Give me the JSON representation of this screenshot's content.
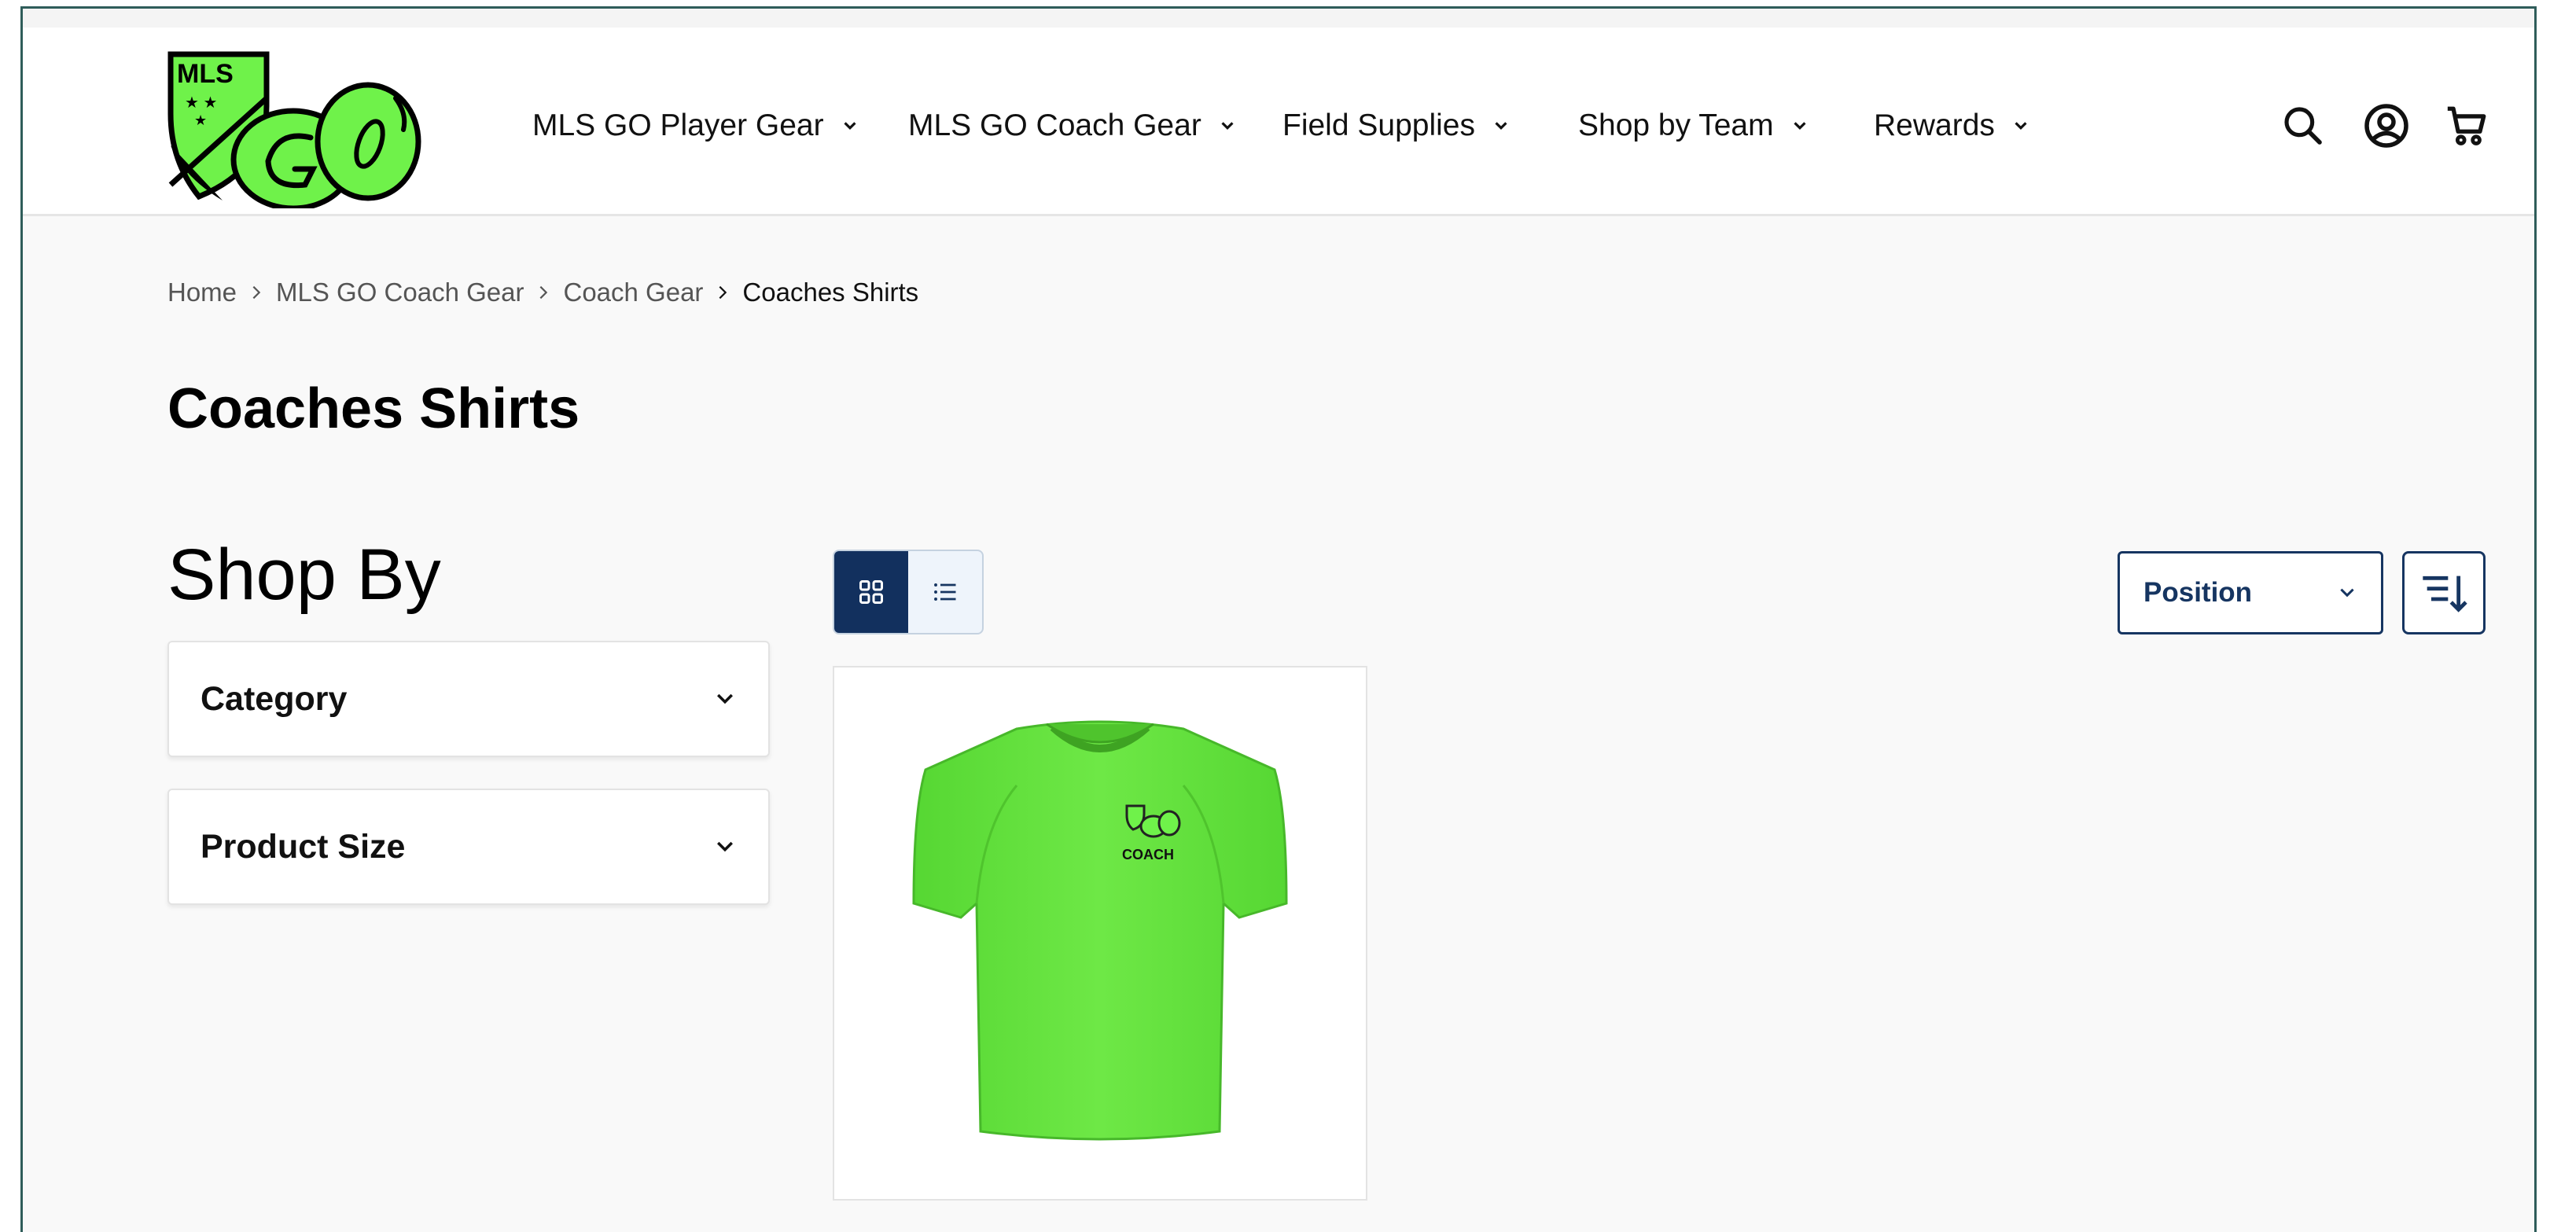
{
  "header": {
    "logo_alt": "MLS GO",
    "logo_text_top": "MLS",
    "nav": [
      {
        "label": "MLS GO Player Gear"
      },
      {
        "label": "MLS GO Coach Gear"
      },
      {
        "label": "Field Supplies"
      },
      {
        "label": "Shop by Team"
      },
      {
        "label": "Rewards"
      }
    ],
    "icons": [
      "search-icon",
      "account-icon",
      "cart-icon"
    ]
  },
  "breadcrumb": {
    "items": [
      "Home",
      "MLS GO Coach Gear",
      "Coach Gear"
    ],
    "current": "Coaches Shirts"
  },
  "page": {
    "title": "Coaches Shirts"
  },
  "sidebar": {
    "heading": "Shop By",
    "filters": [
      {
        "label": "Category"
      },
      {
        "label": "Product Size"
      }
    ]
  },
  "toolbar": {
    "view_modes": [
      "grid",
      "list"
    ],
    "active_view": "grid",
    "sort_selected": "Position"
  },
  "product": {
    "shirt_text": "COACH"
  },
  "colors": {
    "brand_green": "#6ff24a",
    "navy": "#163561",
    "frame": "#2f5d5a"
  }
}
